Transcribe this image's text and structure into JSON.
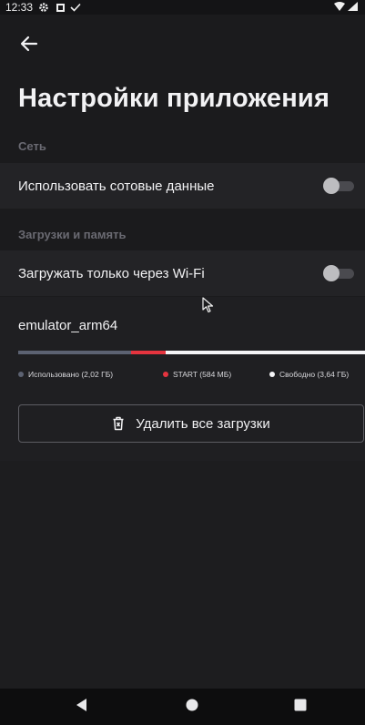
{
  "status_bar": {
    "time": "12:33",
    "icons": [
      "gear-icon",
      "notification-square-icon",
      "check-icon",
      "wifi-icon",
      "signal-icon"
    ]
  },
  "toolbar": {
    "back_icon": "arrow-left-icon"
  },
  "title": "Настройки приложения",
  "sections": {
    "network": {
      "header": "Сеть",
      "cellular_label": "Использовать сотовые данные",
      "cellular_enabled": false
    },
    "downloads": {
      "header": "Загрузки и память",
      "wifi_only_label": "Загружать только через Wi-Fi",
      "wifi_only_enabled": false
    }
  },
  "storage": {
    "device_name": "emulator_arm64",
    "bar": {
      "used_fraction": 0.325,
      "app_fraction": 0.1
    },
    "legend": {
      "used": "Использовано (2,02 ГБ)",
      "app": "START (584 МБ)",
      "free": "Свободно (3,64 ГБ)"
    },
    "colors": {
      "used": "#5c6272",
      "app": "#e5343f",
      "free": "#f4f4f6"
    },
    "delete_button": "Удалить все загрузки"
  },
  "nav_bar": {
    "back": "nav-back-icon",
    "home": "nav-home-icon",
    "recents": "nav-recents-icon"
  }
}
